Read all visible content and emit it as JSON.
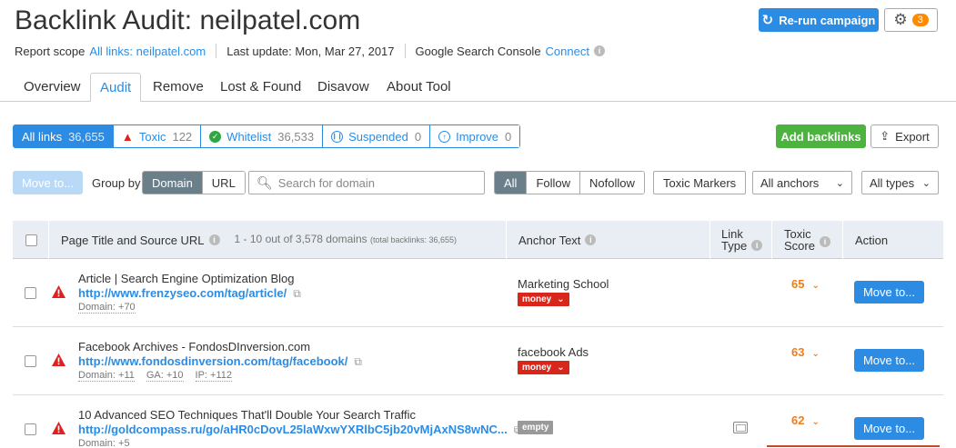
{
  "header": {
    "title": "Backlink Audit: neilpatel.com",
    "rerun_label": "Re-run campaign",
    "settings_badge": "3"
  },
  "meta": {
    "scope_label": "Report scope",
    "scope_link": "All links: neilpatel.com",
    "last_update": "Last update: Mon, Mar 27, 2017",
    "gsc_label": "Google Search Console",
    "gsc_link": "Connect"
  },
  "tabs": [
    {
      "label": "Overview"
    },
    {
      "label": "Audit",
      "active": true
    },
    {
      "label": "Remove"
    },
    {
      "label": "Lost & Found"
    },
    {
      "label": "Disavow"
    },
    {
      "label": "About Tool"
    }
  ],
  "filters": [
    {
      "label": "All links",
      "count": "36,655",
      "active": true
    },
    {
      "label": "Toxic",
      "count": "122",
      "icon": "warning-icon"
    },
    {
      "label": "Whitelist",
      "count": "36,533",
      "icon": "check-icon"
    },
    {
      "label": "Suspended",
      "count": "0",
      "icon": "pause-icon"
    },
    {
      "label": "Improve",
      "count": "0",
      "icon": "arrow-up-icon"
    }
  ],
  "actions": {
    "add_backlinks": "Add backlinks",
    "export": "Export"
  },
  "toolbar": {
    "move_to": "Move to...",
    "group_by_label": "Group by",
    "group_options": [
      "Domain",
      "URL"
    ],
    "search_placeholder": "Search for domain",
    "follow_options": [
      "All",
      "Follow",
      "Nofollow"
    ],
    "toxic_markers": "Toxic Markers",
    "anchors_select": "All anchors",
    "types_select": "All types"
  },
  "table": {
    "headers": {
      "page": "Page Title and Source URL",
      "range": "1 - 10 out of 3,578 domains",
      "total_note": "(total backlinks: 36,655)",
      "anchor": "Anchor Text",
      "link_type_1": "Link",
      "link_type_2": "Type",
      "toxic_1": "Toxic",
      "toxic_2": "Score",
      "action": "Action"
    },
    "rows": [
      {
        "title": "Article | Search Engine Optimization Blog",
        "url": "http://www.frenzyseo.com/tag/article/",
        "meta": [
          "Domain: +70"
        ],
        "anchor": "Marketing School",
        "tag": "money",
        "score": "65",
        "action": "Move to..."
      },
      {
        "title": "Facebook Archives - FondosDInversion.com",
        "url": "http://www.fondosdinversion.com/tag/facebook/",
        "meta": [
          "Domain: +11",
          "GA: +10",
          "IP: +112"
        ],
        "anchor": "facebook Ads",
        "tag": "money",
        "score": "63",
        "action": "Move to..."
      },
      {
        "title": "10 Advanced SEO Techniques That'll Double Your Search Traffic",
        "url": "http://goldcompass.ru/go/aHR0cDovL25laWxwYXRlbC5jb20vMjAxNS8wNC...",
        "meta": [
          "Domain: +5"
        ],
        "anchor": "",
        "tag": "empty",
        "score": "62",
        "action": "Move to..."
      }
    ]
  },
  "colors": {
    "accent": "#2c8ce3",
    "green": "#4bb33e",
    "toxic_red": "#d8261b",
    "score_orange": "#f07d1a",
    "badge_orange": "#ff8a00"
  }
}
